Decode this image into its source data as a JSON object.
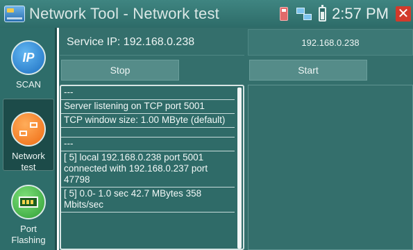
{
  "window": {
    "title": "Network Tool - Network test",
    "time": "2:57 PM",
    "close_symbol": "✕"
  },
  "icons": {
    "app": "network-tool-app-icon",
    "sd_card": "sd-card-icon",
    "network": "network-status-icon",
    "battery": "battery-icon",
    "close": "close-icon"
  },
  "sidebar": {
    "items": [
      {
        "label": "SCAN",
        "icon_text": "IP",
        "icon": "ip-scan-icon"
      },
      {
        "label": "Network test",
        "icon": "lan-icon"
      },
      {
        "label": "Port Flashing",
        "icon": "port-flashing-icon"
      }
    ]
  },
  "main": {
    "service_ip": "Service IP: 192.168.0.238",
    "target_ip": "192.168.0.238",
    "stop_label": "Stop",
    "start_label": "Start",
    "log": [
      "---",
      "Server listening on TCP port 5001",
      "TCP window size: 1.00 MByte (default)",
      "",
      "---",
      "[  5] local 192.168.0.238 port 5001 connected with 192.168.0.237 port 47798",
      "[  5]  0.0- 1.0 sec  42.7 MBytes   358 Mbits/sec"
    ]
  },
  "colors": {
    "titlebar": "#3a7c78",
    "background": "#346f6c",
    "close": "#d23a2b"
  }
}
